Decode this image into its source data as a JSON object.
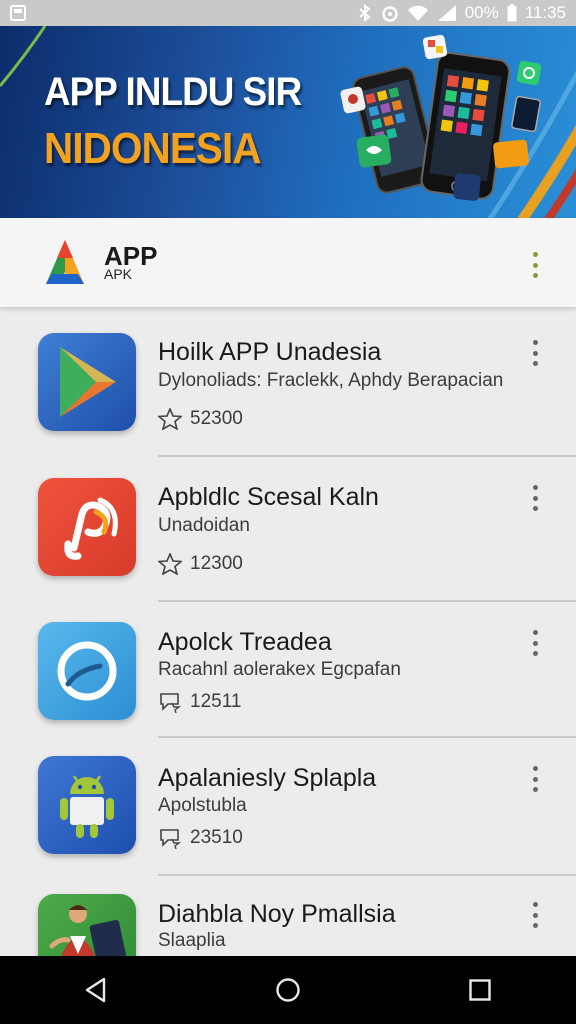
{
  "status_bar": {
    "battery": "00%",
    "time": "11:35",
    "icons": [
      "gallery-icon",
      "bluetooth-icon",
      "alarm-icon",
      "wifi-icon",
      "signal-icon",
      "battery-icon"
    ]
  },
  "banner": {
    "title_line1": "APP INLDU SIR",
    "title_line2": "NIDONESIA"
  },
  "header": {
    "brand_name": "APP",
    "brand_sub": "APK"
  },
  "apps": [
    {
      "name": "Hoilk APP Unadesia",
      "desc": "Dylonoliads: Fraclekk, Aphdy Berapacian",
      "rating": "52300",
      "icon": "play-triangle-icon"
    },
    {
      "name": "Apbldlc Scesal Kaln",
      "desc": "Unadoidan",
      "rating": "12300",
      "icon": "swirl-logo-icon"
    },
    {
      "name": "Apolck Treadea",
      "desc": "Racahnl aolerakex Egcpafan",
      "rating": "12511",
      "icon": "ring-logo-icon"
    },
    {
      "name": "Apalaniesly Splapla",
      "desc": "Apolstubla",
      "rating": "23510",
      "icon": "android-robot-icon"
    },
    {
      "name": "Diahbla Noy Pmallsia",
      "desc": "Slaaplia",
      "rating": "",
      "icon": "person-avatar-icon"
    }
  ],
  "colors": {
    "banner_accent": "#f3a21f",
    "banner_blue": "#1d4f9c",
    "nav_bar": "#000000"
  }
}
